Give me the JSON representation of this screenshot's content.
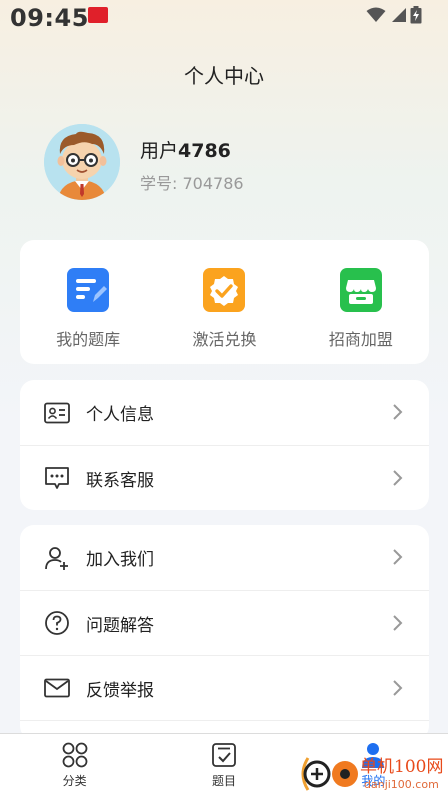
{
  "status_bar": {
    "time": "09:45"
  },
  "header": {
    "title": "个人中心"
  },
  "profile": {
    "username_prefix": "用户",
    "username_number": "4786",
    "student_id": "学号: 704786"
  },
  "quick_actions": [
    {
      "label": "我的题库",
      "icon": "question-bank-icon",
      "color": "#2f7ef6"
    },
    {
      "label": "激活兑换",
      "icon": "activate-badge-icon",
      "color": "#fba31e"
    },
    {
      "label": "招商加盟",
      "icon": "store-icon",
      "color": "#28c04d"
    }
  ],
  "menu_group1": [
    {
      "label": "个人信息",
      "icon": "id-card-icon"
    },
    {
      "label": "联系客服",
      "icon": "chat-icon"
    }
  ],
  "menu_group2": [
    {
      "label": "加入我们",
      "icon": "add-user-icon"
    },
    {
      "label": "问题解答",
      "icon": "help-icon"
    },
    {
      "label": "反馈举报",
      "icon": "mail-icon"
    }
  ],
  "tabbar": [
    {
      "label": "分类",
      "icon": "grid-icon",
      "active": false
    },
    {
      "label": "题目",
      "icon": "checklist-icon",
      "active": false
    },
    {
      "label": "我的",
      "icon": "person-icon",
      "active": true
    }
  ],
  "watermark": {
    "text1": "单机100网",
    "text2": "danji100.com"
  },
  "colors": {
    "accent": "#1e6ff0",
    "background": "#f3f5f9",
    "card": "#ffffff"
  }
}
